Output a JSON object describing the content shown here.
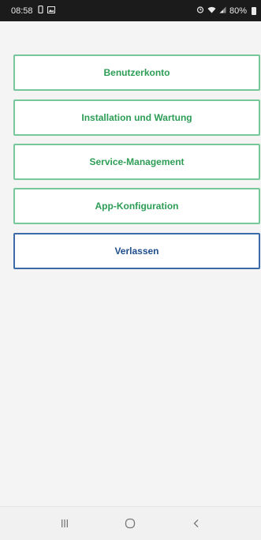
{
  "status_bar": {
    "time": "08:58",
    "battery": "80%",
    "left_icons": [
      "phone-vibrate-icon",
      "image-icon"
    ],
    "right_icons": [
      "alarm-icon",
      "wifi-icon",
      "signal-icon",
      "battery-icon"
    ]
  },
  "menu": {
    "items": [
      {
        "label": "Benutzerkonto"
      },
      {
        "label": "Installation und Wartung"
      },
      {
        "label": "Service-Management"
      },
      {
        "label": "App-Konfiguration"
      },
      {
        "label": "Verlassen"
      }
    ]
  },
  "colors": {
    "menu_border": "#77c79a",
    "menu_text": "#2d9d56",
    "exit_border": "#3a6aa8",
    "exit_text": "#1f4e8c"
  },
  "nav_bar": {
    "icons": [
      "recent-apps-icon",
      "home-icon",
      "back-icon"
    ]
  }
}
